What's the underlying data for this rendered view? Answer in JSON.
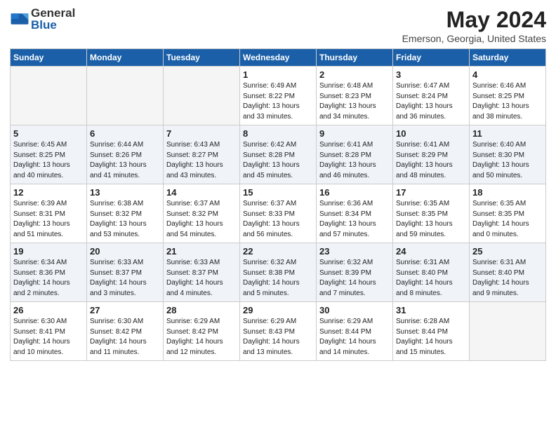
{
  "logo": {
    "general": "General",
    "blue": "Blue"
  },
  "title": "May 2024",
  "subtitle": "Emerson, Georgia, United States",
  "days_of_week": [
    "Sunday",
    "Monday",
    "Tuesday",
    "Wednesday",
    "Thursday",
    "Friday",
    "Saturday"
  ],
  "weeks": [
    [
      {
        "day": "",
        "empty": true
      },
      {
        "day": "",
        "empty": true
      },
      {
        "day": "",
        "empty": true
      },
      {
        "day": "1",
        "sunrise": "6:49 AM",
        "sunset": "8:22 PM",
        "daylight": "13 hours and 33 minutes."
      },
      {
        "day": "2",
        "sunrise": "6:48 AM",
        "sunset": "8:23 PM",
        "daylight": "13 hours and 34 minutes."
      },
      {
        "day": "3",
        "sunrise": "6:47 AM",
        "sunset": "8:24 PM",
        "daylight": "13 hours and 36 minutes."
      },
      {
        "day": "4",
        "sunrise": "6:46 AM",
        "sunset": "8:25 PM",
        "daylight": "13 hours and 38 minutes."
      }
    ],
    [
      {
        "day": "5",
        "sunrise": "6:45 AM",
        "sunset": "8:25 PM",
        "daylight": "13 hours and 40 minutes."
      },
      {
        "day": "6",
        "sunrise": "6:44 AM",
        "sunset": "8:26 PM",
        "daylight": "13 hours and 41 minutes."
      },
      {
        "day": "7",
        "sunrise": "6:43 AM",
        "sunset": "8:27 PM",
        "daylight": "13 hours and 43 minutes."
      },
      {
        "day": "8",
        "sunrise": "6:42 AM",
        "sunset": "8:28 PM",
        "daylight": "13 hours and 45 minutes."
      },
      {
        "day": "9",
        "sunrise": "6:41 AM",
        "sunset": "8:28 PM",
        "daylight": "13 hours and 46 minutes."
      },
      {
        "day": "10",
        "sunrise": "6:41 AM",
        "sunset": "8:29 PM",
        "daylight": "13 hours and 48 minutes."
      },
      {
        "day": "11",
        "sunrise": "6:40 AM",
        "sunset": "8:30 PM",
        "daylight": "13 hours and 50 minutes."
      }
    ],
    [
      {
        "day": "12",
        "sunrise": "6:39 AM",
        "sunset": "8:31 PM",
        "daylight": "13 hours and 51 minutes."
      },
      {
        "day": "13",
        "sunrise": "6:38 AM",
        "sunset": "8:32 PM",
        "daylight": "13 hours and 53 minutes."
      },
      {
        "day": "14",
        "sunrise": "6:37 AM",
        "sunset": "8:32 PM",
        "daylight": "13 hours and 54 minutes."
      },
      {
        "day": "15",
        "sunrise": "6:37 AM",
        "sunset": "8:33 PM",
        "daylight": "13 hours and 56 minutes."
      },
      {
        "day": "16",
        "sunrise": "6:36 AM",
        "sunset": "8:34 PM",
        "daylight": "13 hours and 57 minutes."
      },
      {
        "day": "17",
        "sunrise": "6:35 AM",
        "sunset": "8:35 PM",
        "daylight": "13 hours and 59 minutes."
      },
      {
        "day": "18",
        "sunrise": "6:35 AM",
        "sunset": "8:35 PM",
        "daylight": "14 hours and 0 minutes."
      }
    ],
    [
      {
        "day": "19",
        "sunrise": "6:34 AM",
        "sunset": "8:36 PM",
        "daylight": "14 hours and 2 minutes."
      },
      {
        "day": "20",
        "sunrise": "6:33 AM",
        "sunset": "8:37 PM",
        "daylight": "14 hours and 3 minutes."
      },
      {
        "day": "21",
        "sunrise": "6:33 AM",
        "sunset": "8:37 PM",
        "daylight": "14 hours and 4 minutes."
      },
      {
        "day": "22",
        "sunrise": "6:32 AM",
        "sunset": "8:38 PM",
        "daylight": "14 hours and 5 minutes."
      },
      {
        "day": "23",
        "sunrise": "6:32 AM",
        "sunset": "8:39 PM",
        "daylight": "14 hours and 7 minutes."
      },
      {
        "day": "24",
        "sunrise": "6:31 AM",
        "sunset": "8:40 PM",
        "daylight": "14 hours and 8 minutes."
      },
      {
        "day": "25",
        "sunrise": "6:31 AM",
        "sunset": "8:40 PM",
        "daylight": "14 hours and 9 minutes."
      }
    ],
    [
      {
        "day": "26",
        "sunrise": "6:30 AM",
        "sunset": "8:41 PM",
        "daylight": "14 hours and 10 minutes."
      },
      {
        "day": "27",
        "sunrise": "6:30 AM",
        "sunset": "8:42 PM",
        "daylight": "14 hours and 11 minutes."
      },
      {
        "day": "28",
        "sunrise": "6:29 AM",
        "sunset": "8:42 PM",
        "daylight": "14 hours and 12 minutes."
      },
      {
        "day": "29",
        "sunrise": "6:29 AM",
        "sunset": "8:43 PM",
        "daylight": "14 hours and 13 minutes."
      },
      {
        "day": "30",
        "sunrise": "6:29 AM",
        "sunset": "8:44 PM",
        "daylight": "14 hours and 14 minutes."
      },
      {
        "day": "31",
        "sunrise": "6:28 AM",
        "sunset": "8:44 PM",
        "daylight": "14 hours and 15 minutes."
      },
      {
        "day": "",
        "empty": true
      }
    ]
  ],
  "labels": {
    "sunrise": "Sunrise:",
    "sunset": "Sunset:",
    "daylight": "Daylight:"
  }
}
